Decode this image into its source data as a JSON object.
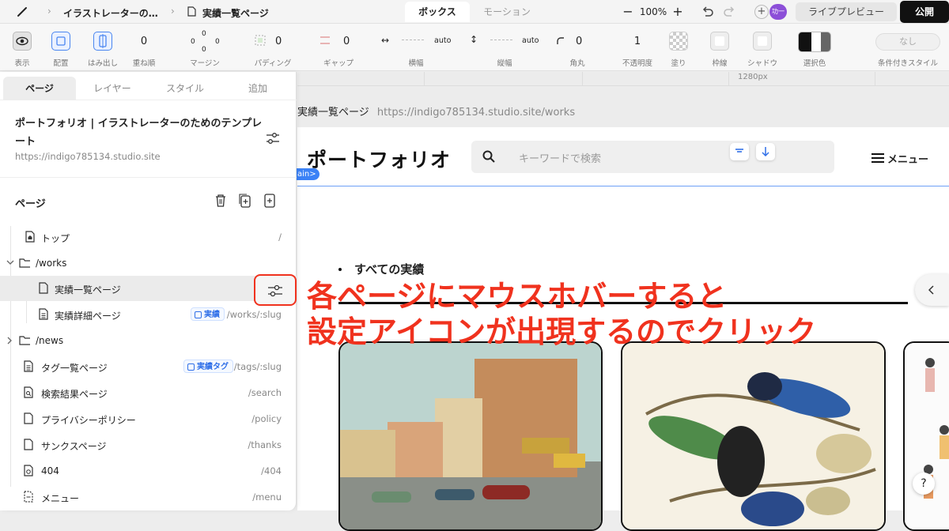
{
  "topbar": {
    "crumb_project": "イラストレーターの…",
    "crumb_page": "実績一覧ページ",
    "tab_box": "ボックス",
    "tab_motion": "モーション",
    "zoom_minus": "−",
    "zoom": "100%",
    "zoom_plus": "+",
    "avatar_text": "功一",
    "live_preview": "ライブプレビュー",
    "publish": "公開"
  },
  "toolbar": {
    "display": "表示",
    "layout": "配置",
    "overflow": "はみ出し",
    "zindex_value": "0",
    "zindex": "重ね順",
    "margin_top": "0",
    "margin_left": "0",
    "margin_right": "0",
    "margin_bottom": "0",
    "margin": "マージン",
    "padding_value": "0",
    "padding": "パディング",
    "gap_value": "0",
    "gap": "ギャップ",
    "width_value": "auto",
    "width": "横幅",
    "height_value": "auto",
    "height": "縦幅",
    "radius_value": "0",
    "radius": "角丸",
    "opacity_value": "1",
    "opacity": "不透明度",
    "fill": "塗り",
    "border": "枠線",
    "shadow": "シャドウ",
    "selection_color": "選択色",
    "conditional_value": "なし",
    "conditional": "条件付きスタイル"
  },
  "panel": {
    "tabs": [
      "ページ",
      "レイヤー",
      "スタイル",
      "追加"
    ],
    "site_title": "ポートフォリオ | イラストレーターのためのテンプレート",
    "site_url": "https://indigo785134.studio.site",
    "section_label": "ページ",
    "pages": [
      {
        "name": "トップ",
        "path": "/"
      },
      {
        "name": "/works",
        "path": ""
      },
      {
        "name": "実績一覧ページ",
        "path": ""
      },
      {
        "name": "実績詳細ページ",
        "chip": "実績",
        "path": "/works/:slug"
      },
      {
        "name": "/news",
        "path": ""
      },
      {
        "name": "タグ一覧ページ",
        "chip": "実績タグ",
        "path": "/tags/:slug"
      },
      {
        "name": "検索結果ページ",
        "path": "/search"
      },
      {
        "name": "プライバシーポリシー",
        "path": "/policy"
      },
      {
        "name": "サンクスページ",
        "path": "/thanks"
      },
      {
        "name": "404",
        "path": "/404"
      },
      {
        "name": "メニュー",
        "path": "/menu"
      }
    ]
  },
  "canvas": {
    "ruler_label": "1280px",
    "page_name": "実績一覧ページ",
    "page_url": "https://indigo785134.studio.site/works",
    "logo": "ポートフォリオ",
    "search_placeholder": "キーワードで検索",
    "menu_label": "メニュー",
    "main_tag": "ain>",
    "section_heading": "すべての実績",
    "help": "?"
  },
  "annotation": {
    "line1": "各ページにマウスホバーすると",
    "line2": "設定アイコンが出現するのでクリック"
  },
  "colors": {
    "accent_red": "#f0321e",
    "accent_blue": "#2f6fe8",
    "publish_bg": "#111111"
  }
}
